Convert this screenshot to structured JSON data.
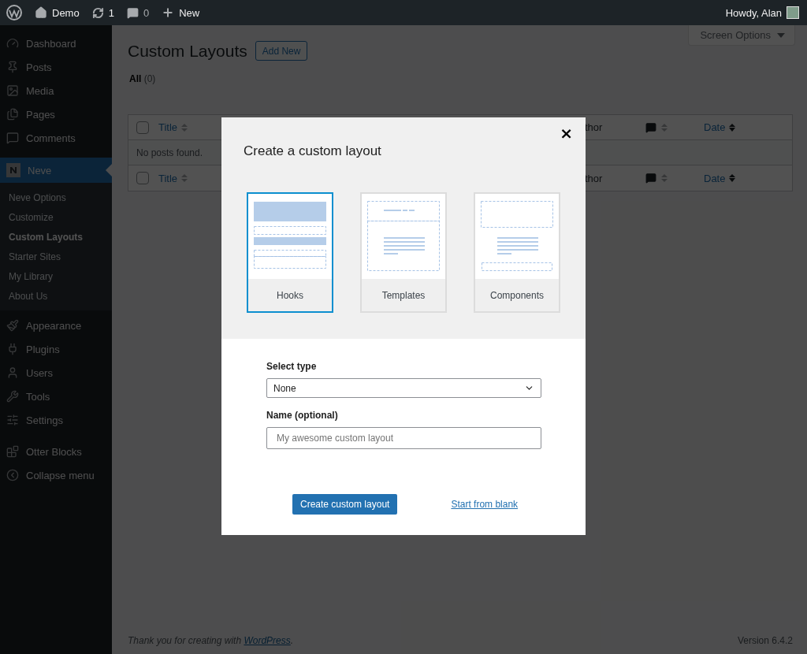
{
  "admin_bar": {
    "site": "Demo",
    "updates": "1",
    "comments": "0",
    "new": "New",
    "greeting": "Howdy, Alan"
  },
  "sidebar": {
    "items": [
      {
        "label": "Dashboard",
        "selected": false
      },
      {
        "label": "Posts",
        "selected": false
      },
      {
        "label": "Media",
        "selected": false
      },
      {
        "label": "Pages",
        "selected": false
      },
      {
        "label": "Comments",
        "selected": false
      },
      {
        "label": "Neve",
        "selected": true,
        "children": [
          {
            "label": "Neve Options",
            "selected": false
          },
          {
            "label": "Customize",
            "selected": false
          },
          {
            "label": "Custom Layouts",
            "selected": true
          },
          {
            "label": "Starter Sites",
            "selected": false
          },
          {
            "label": "My Library",
            "selected": false
          },
          {
            "label": "About Us",
            "selected": false
          }
        ]
      },
      {
        "label": "Appearance",
        "selected": false
      },
      {
        "label": "Plugins",
        "selected": false
      },
      {
        "label": "Users",
        "selected": false
      },
      {
        "label": "Tools",
        "selected": false
      },
      {
        "label": "Settings",
        "selected": false
      },
      {
        "label": "Otter Blocks",
        "selected": false
      },
      {
        "label": "Collapse menu",
        "selected": false
      }
    ]
  },
  "page": {
    "title": "Custom Layouts",
    "add_new": "Add New",
    "screen_options": "Screen Options",
    "filters": [
      {
        "label": "All",
        "count": "(0)",
        "selected": true
      }
    ]
  },
  "table": {
    "header": {
      "checked": false,
      "columns": [
        {
          "kind": "sortable",
          "label": "Title"
        },
        {
          "kind": "text",
          "label": "thor"
        },
        {
          "kind": "comments"
        },
        {
          "kind": "sorted",
          "label": "Date"
        }
      ]
    },
    "empty_message": "No posts found.",
    "footer": {
      "checked": false,
      "columns": [
        {
          "kind": "sortable",
          "label": "Title"
        },
        {
          "kind": "text",
          "label": "thor"
        },
        {
          "kind": "comments"
        },
        {
          "kind": "sorted",
          "label": "Date"
        }
      ]
    }
  },
  "footer": {
    "thanks_before": "Thank you for creating with",
    "thanks_link": "WordPress",
    "thanks_after": ".",
    "version": "Version 6.4.2"
  },
  "modal": {
    "title": "Create a custom layout",
    "close": "×",
    "layouts": [
      {
        "kind": "hooks",
        "label": "Hooks",
        "selected": true
      },
      {
        "kind": "templates",
        "label": "Templates",
        "selected": false
      },
      {
        "kind": "components",
        "label": "Components",
        "selected": false
      }
    ],
    "select_type": {
      "label": "Select type",
      "value": "None"
    },
    "name": {
      "label": "Name (optional)",
      "placeholder": "My awesome custom layout"
    },
    "primary_button": "Create custom layout",
    "link": "Start from blank"
  }
}
